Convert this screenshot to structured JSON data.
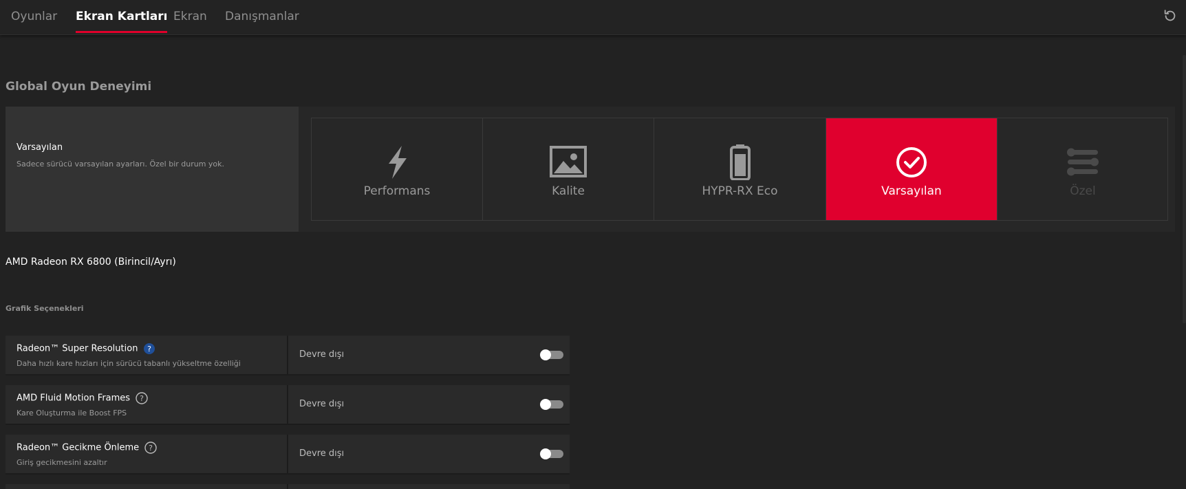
{
  "tabs": [
    {
      "label": "Oyunlar",
      "active": false
    },
    {
      "label": "Ekran Kartları",
      "active": true
    },
    {
      "label": "Ekran",
      "active": false
    },
    {
      "label": "Danışmanlar",
      "active": false
    }
  ],
  "header": {
    "reset_icon": "reset-icon"
  },
  "global": {
    "title": "Global Oyun Deneyimi",
    "selected_name": "Varsayılan",
    "selected_desc": "Sadece sürücü varsayılan ayarları. Özel bir durum yok.",
    "presets": [
      {
        "label": "Performans",
        "icon": "lightning-icon",
        "state": "normal"
      },
      {
        "label": "Kalite",
        "icon": "image-icon",
        "state": "normal"
      },
      {
        "label": "HYPR-RX Eco",
        "icon": "battery-icon",
        "state": "normal"
      },
      {
        "label": "Varsayılan",
        "icon": "check-circle-icon",
        "state": "selected"
      },
      {
        "label": "Özel",
        "icon": "sliders-icon",
        "state": "disabled"
      }
    ]
  },
  "gpu": {
    "name": "AMD Radeon RX 6800 (Birincil/Ayrı)"
  },
  "graphics": {
    "title": "Grafik Seçenekleri",
    "settings": [
      {
        "name": "Radeon™ Super Resolution",
        "desc": "Daha hızlı kare hızları için sürücü tabanlı yükseltme özelliği",
        "value": "Devre dışı",
        "enabled": false,
        "help_style": "filled"
      },
      {
        "name": "AMD Fluid Motion Frames",
        "desc": "Kare Oluşturma ile Boost FPS",
        "value": "Devre dışı",
        "enabled": false,
        "help_style": "outline"
      },
      {
        "name": "Radeon™ Gecikme Önleme",
        "desc": "Giriş gecikmesini azaltır",
        "value": "Devre dışı",
        "enabled": false,
        "help_style": "outline"
      }
    ]
  },
  "colors": {
    "accent": "#e0002e",
    "background": "#222222",
    "panel": "#2a2a2a"
  }
}
